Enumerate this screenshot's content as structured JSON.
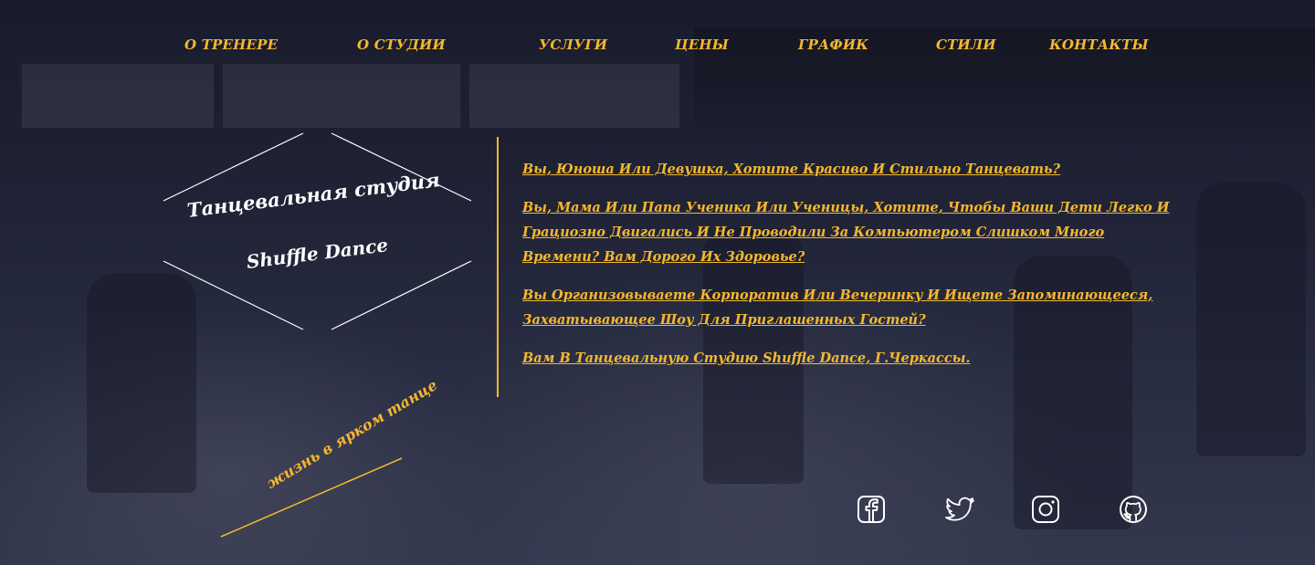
{
  "nav": {
    "items": [
      {
        "label": "О ТРЕНЕРЕ"
      },
      {
        "label": "О СТУДИИ"
      },
      {
        "label": "УСЛУГИ"
      },
      {
        "label": "ЦЕНЫ"
      },
      {
        "label": "ГРАФИК"
      },
      {
        "label": "СТИЛИ"
      },
      {
        "label": "КОНТАКТЫ"
      }
    ]
  },
  "logo": {
    "line1": "Танцевальная  студия",
    "line2": "Shuffle Dance"
  },
  "tagline": "жизнь в ярком танце",
  "content": {
    "paragraphs": [
      "Вы, Юноша Или Девушка, Хотите Красиво И Стильно Танцевать?",
      "Вы, Мама Или Папа Ученика Или Ученицы, Хотите, Чтобы Ваши Дети Легко И Грациозно Двигались И Не Проводили За Компьютером Слишком Много Времени? Вам Дорого Их Здоровье?",
      "Вы Организовываете Корпоратив Или Вечеринку И Ищете Запоминающееся, Захватывающее Шоу Для Приглашенных Гостей?",
      "Вам В Танцевальную Студию Shuffle Dance, Г.Черкассы."
    ]
  },
  "social": {
    "icons": [
      "facebook-icon",
      "twitter-icon",
      "instagram-icon",
      "github-icon"
    ]
  },
  "colors": {
    "accent": "#f5b82e",
    "white": "#ffffff",
    "overlay": "#181a2c"
  }
}
